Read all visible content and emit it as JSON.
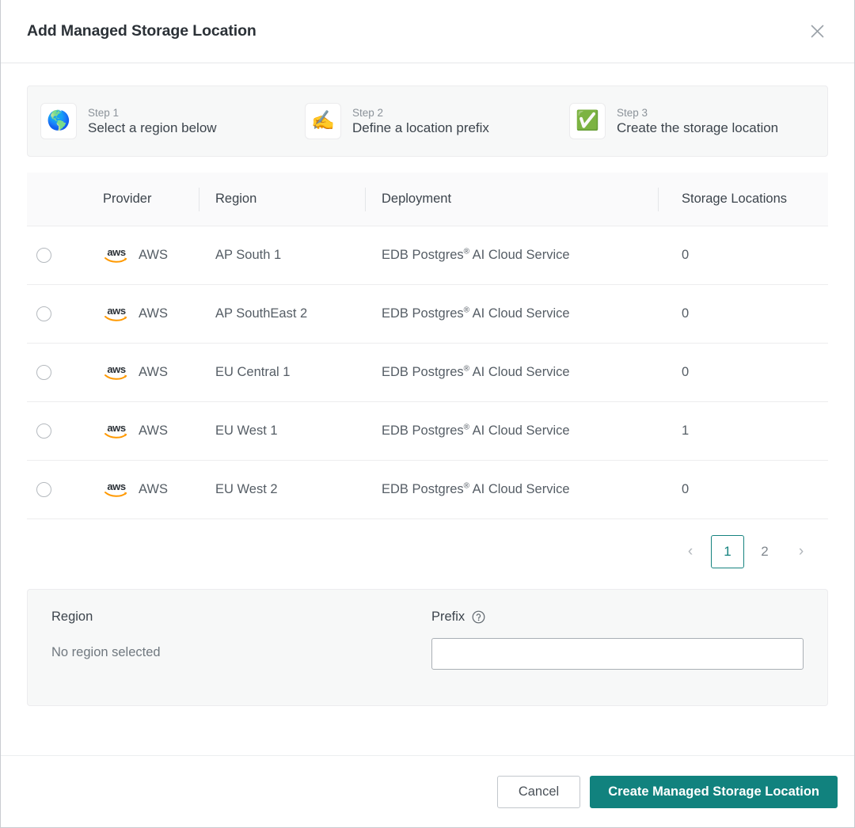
{
  "header": {
    "title": "Add Managed Storage Location",
    "close_icon": "close-icon"
  },
  "stepper": {
    "steps": [
      {
        "num": "Step 1",
        "label": "Select a region below",
        "icon": "🌎",
        "icon_name": "globe-icon"
      },
      {
        "num": "Step 2",
        "label": "Define a location prefix",
        "icon": "✍️",
        "icon_name": "writing-hand-icon"
      },
      {
        "num": "Step 3",
        "label": "Create the storage location",
        "icon": "✅",
        "icon_name": "check-mark-icon"
      }
    ]
  },
  "table": {
    "columns": [
      "Provider",
      "Region",
      "Deployment",
      "Storage Locations"
    ],
    "rows": [
      {
        "provider": "AWS",
        "provider_logo": "aws",
        "region": "AP South 1",
        "deployment_pre": "EDB Postgres",
        "deployment_sup": "®",
        "deployment_post": " AI Cloud Service",
        "storage_locations": "0",
        "selected": false
      },
      {
        "provider": "AWS",
        "provider_logo": "aws",
        "region": "AP SouthEast 2",
        "deployment_pre": "EDB Postgres",
        "deployment_sup": "®",
        "deployment_post": " AI Cloud Service",
        "storage_locations": "0",
        "selected": false
      },
      {
        "provider": "AWS",
        "provider_logo": "aws",
        "region": "EU Central 1",
        "deployment_pre": "EDB Postgres",
        "deployment_sup": "®",
        "deployment_post": " AI Cloud Service",
        "storage_locations": "0",
        "selected": false
      },
      {
        "provider": "AWS",
        "provider_logo": "aws",
        "region": "EU West 1",
        "deployment_pre": "EDB Postgres",
        "deployment_sup": "®",
        "deployment_post": " AI Cloud Service",
        "storage_locations": "1",
        "selected": false
      },
      {
        "provider": "AWS",
        "provider_logo": "aws",
        "region": "EU West 2",
        "deployment_pre": "EDB Postgres",
        "deployment_sup": "®",
        "deployment_post": " AI Cloud Service",
        "storage_locations": "0",
        "selected": false
      }
    ]
  },
  "pagination": {
    "prev": "‹",
    "next": "›",
    "pages": [
      "1",
      "2"
    ],
    "active_page": "1"
  },
  "region_panel": {
    "region_label": "Region",
    "region_value": "No region selected",
    "prefix_label": "Prefix",
    "prefix_help_icon": "help-circle-icon",
    "prefix_value": "",
    "prefix_placeholder": ""
  },
  "footer": {
    "cancel_label": "Cancel",
    "create_label": "Create Managed Storage Location"
  },
  "colors": {
    "accent_teal": "#11827e",
    "pagination_active": "#16837f",
    "aws_orange": "#ff9900",
    "panel_bg": "#f7f8f8"
  }
}
